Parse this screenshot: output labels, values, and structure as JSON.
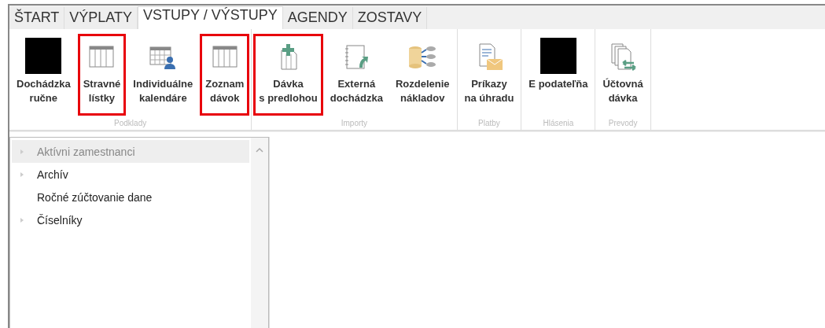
{
  "tabs": [
    {
      "label": "ŠTART",
      "selected": false
    },
    {
      "label": "VÝPLATY",
      "selected": false
    },
    {
      "label": "VSTUPY / VÝSTUPY",
      "selected": true
    },
    {
      "label": "AGENDY",
      "selected": false
    },
    {
      "label": "ZOSTAVY",
      "selected": false
    }
  ],
  "ribbon_groups": [
    {
      "label": "Podklady",
      "buttons": [
        {
          "lines": [
            "Dochádzka",
            "ručne"
          ],
          "kind": "redacted",
          "highlighted": false
        },
        {
          "lines": [
            "Stravné",
            "lístky"
          ],
          "kind": "table",
          "highlighted": true
        },
        {
          "lines": [
            "Individuálne",
            "kalendáre"
          ],
          "kind": "calendar",
          "highlighted": false
        },
        {
          "lines": [
            "Zoznam",
            "dávok"
          ],
          "kind": "table",
          "highlighted": true
        }
      ]
    },
    {
      "label": "Importy",
      "buttons": [
        {
          "lines": [
            "Dávka",
            "s predlohou"
          ],
          "kind": "newdoc",
          "highlighted": true
        },
        {
          "lines": [
            "Externá",
            "dochádzka"
          ],
          "kind": "notebook",
          "highlighted": false
        },
        {
          "lines": [
            "Rozdelenie",
            "nákladov"
          ],
          "kind": "database",
          "highlighted": false
        }
      ]
    },
    {
      "label": "Platby",
      "buttons": [
        {
          "lines": [
            "Príkazy",
            "na úhradu"
          ],
          "kind": "mail",
          "highlighted": false
        }
      ]
    },
    {
      "label": "Hlásenia",
      "buttons": [
        {
          "lines": [
            "E podateľňa"
          ],
          "kind": "redacted",
          "highlighted": false
        }
      ]
    },
    {
      "label": "Prevody",
      "buttons": [
        {
          "lines": [
            "Účtovná",
            "dávka"
          ],
          "kind": "transfer",
          "highlighted": false
        }
      ]
    }
  ],
  "tree": [
    {
      "label": "Aktívni zamestnanci",
      "expandable": true,
      "selected": true
    },
    {
      "label": "Archív",
      "expandable": true,
      "selected": false
    },
    {
      "label": "Ročné zúčtovanie dane",
      "expandable": false,
      "selected": false
    },
    {
      "label": "Číselníky",
      "expandable": true,
      "selected": false
    }
  ]
}
